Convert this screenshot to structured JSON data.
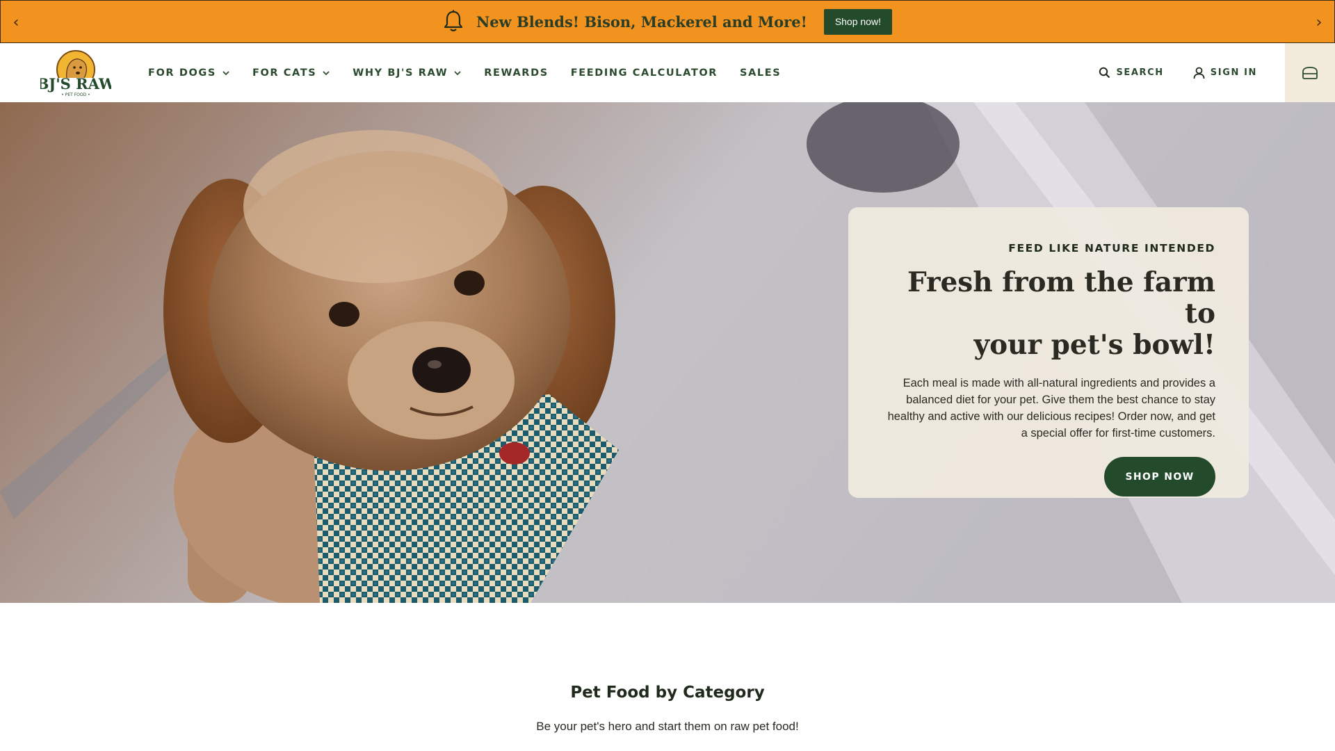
{
  "announcement": {
    "message": "New Blends! Bison, Mackerel and More!",
    "button_label": "Shop now!",
    "prev_icon": "‹",
    "next_icon": "›",
    "background": "#f3931f"
  },
  "header": {
    "logo_text": "BJ'S RAW",
    "logo_subtext": "• PET FOOD •",
    "nav": [
      {
        "label": "FOR DOGS",
        "has_dropdown": true
      },
      {
        "label": "FOR CATS",
        "has_dropdown": true
      },
      {
        "label": "WHY BJ'S RAW",
        "has_dropdown": true
      },
      {
        "label": "REWARDS",
        "has_dropdown": false
      },
      {
        "label": "FEEDING CALCULATOR",
        "has_dropdown": false
      },
      {
        "label": "SALES",
        "has_dropdown": false
      }
    ],
    "search_label": "SEARCH",
    "signin_label": "SIGN IN",
    "brand_green": "#234a2a"
  },
  "hero": {
    "eyebrow": "FEED LIKE NATURE INTENDED",
    "headline_line1": "Fresh from the farm to",
    "headline_line2": "your pet's bowl!",
    "body": "Each meal is made with all-natural ingredients and provides a balanced diet for your pet. Give them the best chance to stay healthy and active with our delicious recipes! Order now, and get a special offer for first-time customers.",
    "cta_label": "SHOP NOW"
  },
  "category": {
    "title": "Pet Food by Category",
    "subtitle": "Be your pet's hero and start them on raw pet food!"
  }
}
